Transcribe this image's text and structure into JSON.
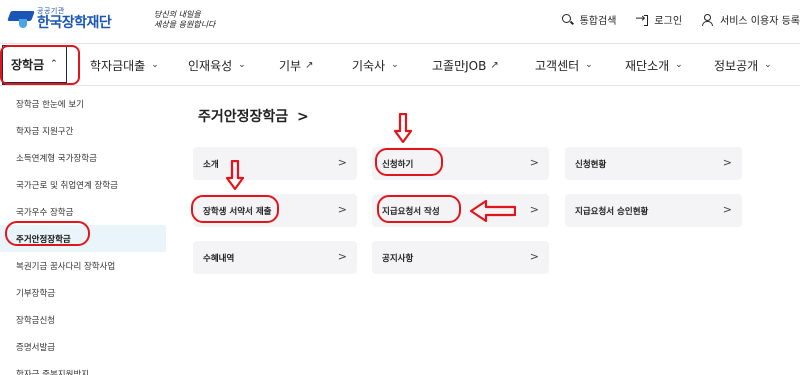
{
  "brand": {
    "small": "공공기관",
    "name": "한국장학재단",
    "slogan_line1": "당신의 내일을",
    "slogan_line2": "세상을 응원합니다"
  },
  "utils": [
    {
      "label": "통합검색",
      "icon": "search-icon"
    },
    {
      "label": "로그인",
      "icon": "login-icon"
    },
    {
      "label": "서비스 이용자 등록",
      "icon": "user-add-icon"
    }
  ],
  "nav": [
    {
      "label": "장학금",
      "mark": "^"
    },
    {
      "label": "학자금대출",
      "mark": "v"
    },
    {
      "label": "인재육성",
      "mark": "v"
    },
    {
      "label": "기부",
      "mark": "ext"
    },
    {
      "label": "기숙사",
      "mark": "v"
    },
    {
      "label": "고졸만JOB",
      "mark": "ext"
    },
    {
      "label": "고객센터",
      "mark": "v"
    },
    {
      "label": "재단소개",
      "mark": "v"
    },
    {
      "label": "정보공개",
      "mark": "v"
    }
  ],
  "sidebar": [
    "장학금 한눈에 보기",
    "학자금 지원구간",
    "소득연계형 국가장학금",
    "국가근로 및 취업연계 장학금",
    "국가우수 장학금",
    "주거안정장학금",
    "복권기금 꿈사다리 장학사업",
    "기부장학금",
    "장학금신청",
    "증명서발급",
    "학자금 중복지원방지"
  ],
  "page": {
    "title": "주거안정장학금",
    "title_arrow": ">"
  },
  "cards": [
    "소개",
    "신청하기",
    "신청현황",
    "장학생 서약서 제출",
    "지급요청서 작성",
    "지급요청서 승인현황",
    "수혜내역",
    "공지사항"
  ],
  "card_arrow": ">",
  "colors": {
    "brand": "#1b56b4",
    "highlight": "#e1151b",
    "sidebar_active_bg": "#eaf4fb",
    "card_bg": "#f4f4f6"
  }
}
